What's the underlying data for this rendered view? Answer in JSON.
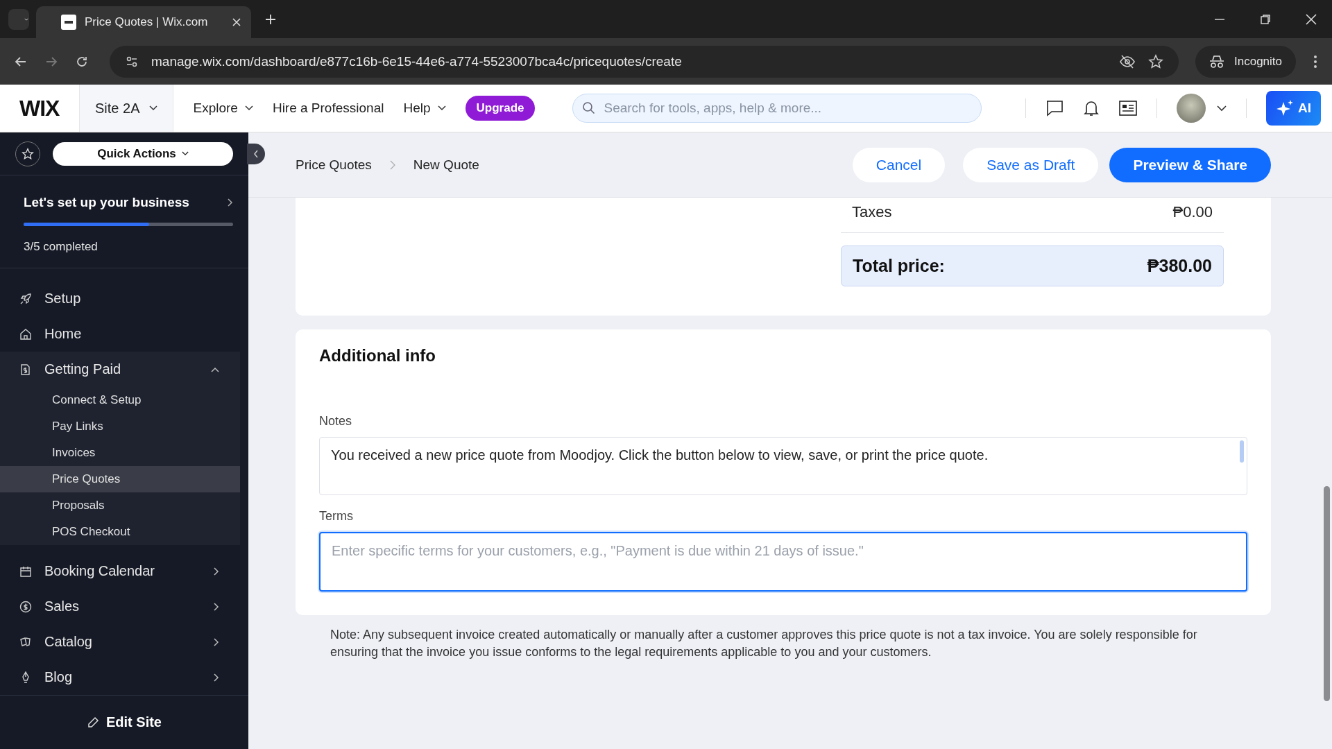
{
  "browser": {
    "tab_title": "Price Quotes | Wix.com",
    "url": "manage.wix.com/dashboard/e877c16b-6e15-44e6-a774-5523007bca4c/pricequotes/create",
    "profile": "Incognito"
  },
  "header": {
    "logo": "WIX",
    "site": "Site 2A",
    "nav": [
      {
        "label": "Explore",
        "dropdown": true
      },
      {
        "label": "Hire a Professional",
        "dropdown": false
      },
      {
        "label": "Help",
        "dropdown": true
      }
    ],
    "upgrade": "Upgrade",
    "search": {
      "placeholder": "Search for tools, apps, help & more..."
    },
    "ai": "AI"
  },
  "sidebar": {
    "quick_actions": "Quick Actions",
    "setup": {
      "title": "Let's set up your business",
      "level": 0.6,
      "status": "3/5 completed"
    },
    "items": [
      {
        "label": "Setup",
        "kind": "link",
        "selected": false
      },
      {
        "label": "Home",
        "kind": "link",
        "selected": false
      },
      {
        "label": "Getting Paid",
        "kind": "section",
        "selected": false,
        "expanded": true,
        "children": [
          {
            "label": "Connect & Setup",
            "selected": false
          },
          {
            "label": "Pay Links",
            "selected": false
          },
          {
            "label": "Invoices",
            "selected": false
          },
          {
            "label": "Price Quotes",
            "selected": true
          },
          {
            "label": "Proposals",
            "selected": false
          },
          {
            "label": "POS Checkout",
            "selected": false
          }
        ]
      },
      {
        "label": "Booking Calendar",
        "kind": "section",
        "selected": false,
        "expanded": false
      },
      {
        "label": "Sales",
        "kind": "section",
        "selected": false,
        "expanded": false
      },
      {
        "label": "Catalog",
        "kind": "section",
        "selected": false,
        "expanded": false
      },
      {
        "label": "Blog",
        "kind": "section",
        "selected": false,
        "expanded": false
      }
    ],
    "edit_site": "Edit Site"
  },
  "breadcrumbs": [
    "Price Quotes",
    "New Quote"
  ],
  "actions": {
    "cancel": "Cancel",
    "save_draft": "Save as Draft",
    "preview": "Preview & Share"
  },
  "summary": {
    "taxes_label": "Taxes",
    "taxes_value": "₱0.00",
    "total_label": "Total price:",
    "total_value": "₱380.00"
  },
  "additional_info": {
    "title": "Additional info",
    "notes": {
      "label": "Notes",
      "value": "You received a new price quote from Moodjoy. Click the button below to view, save, or print the price quote."
    },
    "terms": {
      "label": "Terms",
      "placeholder": "Enter specific terms for your customers, e.g., \"Payment is due within 21 days of issue.\""
    }
  },
  "note": "Note: Any subsequent invoice created automatically or manually after a customer approves this price quote is not a tax invoice. You are solely responsible for ensuring that the invoice you issue conforms to the legal requirements applicable to you and your customers."
}
